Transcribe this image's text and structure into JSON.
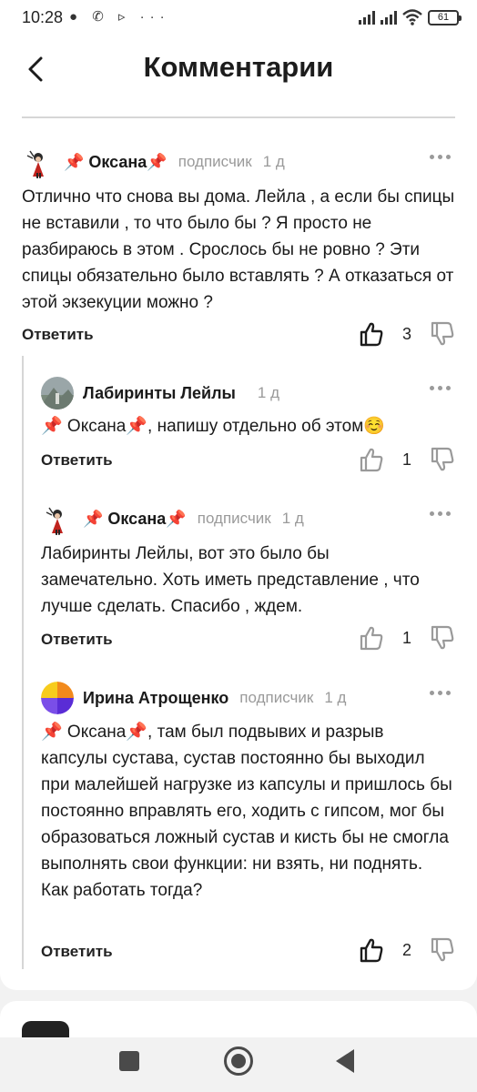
{
  "status_bar": {
    "time": "10:28",
    "left_icons": "●  ✆  ▹  ···",
    "battery": "61"
  },
  "header": {
    "title": "Комментарии"
  },
  "comments": [
    {
      "author": "📌 Оксана📌",
      "role": "подписчик",
      "time": "1 д",
      "text": "Отлично что снова вы дома. Лейла , а если бы спицы не вставили , то что было бы ? Я просто не разбираюсь в этом . Срослось бы не ровно ? Эти спицы обязательно было вставлять ? А отказаться от этой экзекуции можно ?",
      "reply_label": "Ответить",
      "likes": "3",
      "liked": true
    },
    {
      "author": "Лабиринты Лейлы",
      "role": "",
      "time": "1 д",
      "text": "📌 Оксана📌, напишу отдельно об этом☺️",
      "reply_label": "Ответить",
      "likes": "1",
      "liked": false
    },
    {
      "author": "📌 Оксана📌",
      "role": "подписчик",
      "time": "1 д",
      "text": "Лабиринты Лейлы, вот это было бы замечательно. Хоть иметь представление , что лучше сделать. Спасибо , ждем.",
      "reply_label": "Ответить",
      "likes": "1",
      "liked": false
    },
    {
      "author": "Ирина Атрощенко",
      "role": "подписчик",
      "time": "1 д",
      "text": "📌 Оксана📌, там был подвывих и разрыв капсулы сустава, сустав постоянно бы выходил при малейшей нагрузке из капсулы и пришлось бы постоянно вправлять его, ходить с гипсом, мог бы образоваться ложный сустав и кисть бы не смогла выполнять свои функции: ни взять, ни поднять. Как работать тогда?",
      "reply_label": "Ответить",
      "likes": "2",
      "liked": true
    }
  ],
  "colors": {
    "text": "#1a1a1a",
    "muted": "#9a9a9a",
    "divider": "#d6d6d6",
    "background": "#f2f2f2"
  }
}
